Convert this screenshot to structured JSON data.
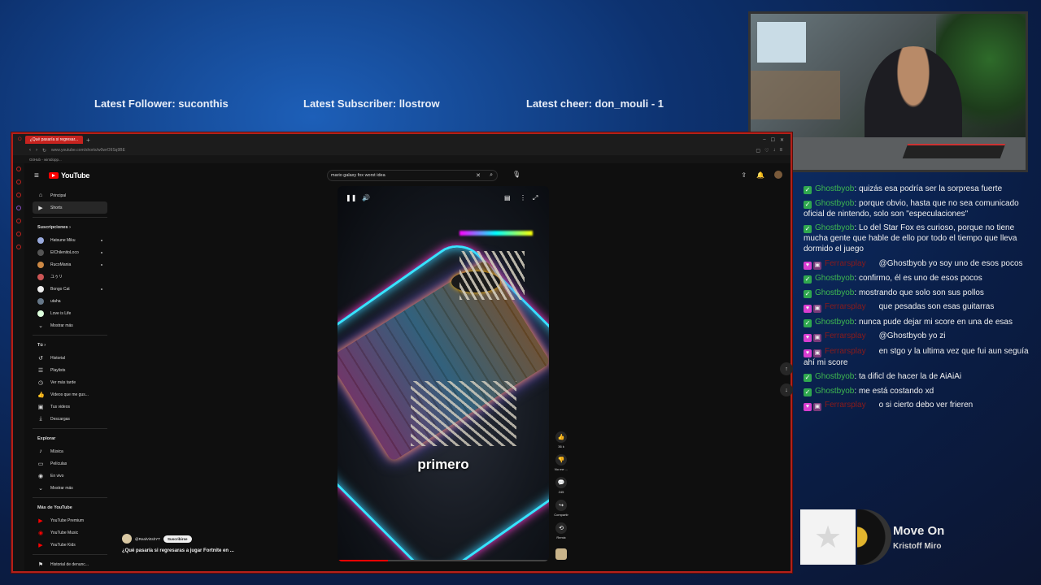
{
  "overlay": {
    "latest_follower": "Latest Follower: suconthis",
    "latest_subscriber": "Latest Subscriber: llostrow",
    "latest_cheer": "Latest cheer: don_mouli - 1"
  },
  "browser": {
    "tab_title": "¿Qué pasaría si regresar...",
    "url": "www.youtube.com/shorts/w0wrO9Sq9BE",
    "bookmark": "GitHub - wintdopp..."
  },
  "youtube": {
    "logo_text": "YouTube",
    "search_value": "mario galaxy fox worst idea",
    "sidebar": {
      "main": [
        {
          "label": "Principal",
          "icon": "home-icon"
        },
        {
          "label": "Shorts",
          "icon": "shorts-icon"
        }
      ],
      "subs_heading": "Suscripciones",
      "subscriptions": [
        "Hatsune Miku",
        "ElChilenitoLoco",
        "RucoMania",
        "ユゥリ",
        "Bongo Cat",
        "utaha",
        "Love is Life"
      ],
      "subs_more": "Mostrar más",
      "you_heading": "Tú",
      "you": [
        {
          "label": "Historial",
          "icon": "history-icon"
        },
        {
          "label": "Playlists",
          "icon": "playlist-icon"
        },
        {
          "label": "Ver más tarde",
          "icon": "clock-icon"
        },
        {
          "label": "Videos que me gus...",
          "icon": "like-icon"
        },
        {
          "label": "Tus videos",
          "icon": "video-icon"
        },
        {
          "label": "Descargas",
          "icon": "download-icon"
        }
      ],
      "explore_heading": "Explorar",
      "explore": [
        {
          "label": "Música",
          "icon": "music-icon"
        },
        {
          "label": "Películas",
          "icon": "film-icon"
        },
        {
          "label": "En vivo",
          "icon": "live-icon"
        },
        {
          "label": "Mostrar más",
          "icon": "chevron-down-icon"
        }
      ],
      "more_heading": "Más de YouTube",
      "more": [
        "YouTube Premium",
        "YouTube Music",
        "YouTube Kids"
      ],
      "report": "Historial de denunc..."
    },
    "short": {
      "caption": "primero",
      "channel": "@RealVirtshYT",
      "subscribe": "Suscribirse",
      "title": "¿Qué pasaría si regresaras a jugar Fortnite en ...",
      "likes": "36 k",
      "dislike": "No me ...",
      "comments": "245",
      "share": "Compartir",
      "remix": "Remix"
    }
  },
  "chat": [
    {
      "type": "mod",
      "user": "Ghostbyob",
      "text": "quizás esa podría ser la sorpresa fuerte"
    },
    {
      "type": "mod",
      "user": "Ghostbyob",
      "text": "porque obvio, hasta que no sea comunicado oficial de nintendo, solo son \"especulaciones\""
    },
    {
      "type": "mod",
      "user": "Ghostbyob",
      "text": "Lo del Star Fox es curioso, porque no tiene mucha gente que hable de ello por todo el tiempo que lleva dormido el juego"
    },
    {
      "type": "sub",
      "user": "Ferrarsplay",
      "text": "@Ghostbyob yo soy uno de esos pocos"
    },
    {
      "type": "mod",
      "user": "Ghostbyob",
      "text": "confirmo, él es uno de esos pocos"
    },
    {
      "type": "mod",
      "user": "Ghostbyob",
      "text": "mostrando que solo son sus pollos"
    },
    {
      "type": "sub",
      "user": "Ferrarsplay",
      "text": "que pesadas son esas guitarras"
    },
    {
      "type": "mod",
      "user": "Ghostbyob",
      "text": "nunca pude dejar mi score en una de esas"
    },
    {
      "type": "sub",
      "user": "Ferrarsplay",
      "text": "@Ghostbyob yo zi"
    },
    {
      "type": "sub",
      "user": "Ferrarsplay",
      "text": "en stgo y la ultima vez que fui aun seguía ahí mi score"
    },
    {
      "type": "mod",
      "user": "Ghostbyob",
      "text": "ta dificl de hacer la de AiAiAi"
    },
    {
      "type": "mod",
      "user": "Ghostbyob",
      "text": "me está costando xd"
    },
    {
      "type": "sub",
      "user": "Ferrarsplay",
      "text": "o si cierto debo ver frieren"
    }
  ],
  "music": {
    "song": "Move On",
    "artist": "Kristoff Miro"
  },
  "colors": {
    "accent_red": "#c6231f",
    "mod_green": "#3fb950",
    "yt_red": "#ff0000"
  }
}
